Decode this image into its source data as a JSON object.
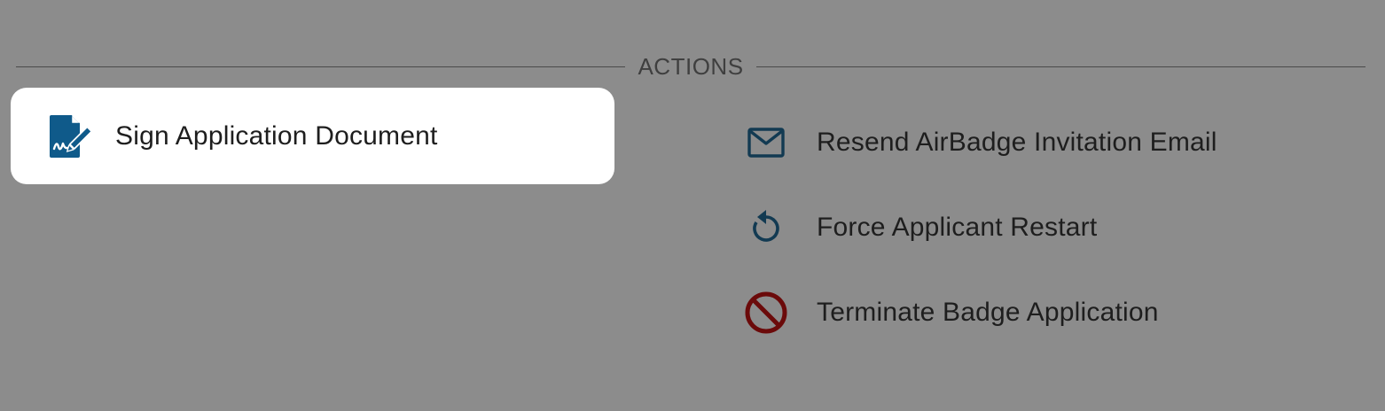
{
  "section": {
    "title": "ACTIONS"
  },
  "actions": [
    {
      "label": "Sign Application Document",
      "icon": "sign-document-icon",
      "highlighted": true
    },
    {
      "label": "Resend AirBadge Invitation Email",
      "icon": "mail-icon"
    },
    {
      "label": "Force Applicant Restart",
      "icon": "restart-icon"
    },
    {
      "label": "Terminate Badge Application",
      "icon": "block-icon"
    }
  ],
  "colors": {
    "background": "#8c8c8c",
    "card": "#ffffff",
    "icon_primary": "#0f5a8a",
    "icon_dark": "#123a52",
    "icon_danger": "#6b0a0a"
  }
}
